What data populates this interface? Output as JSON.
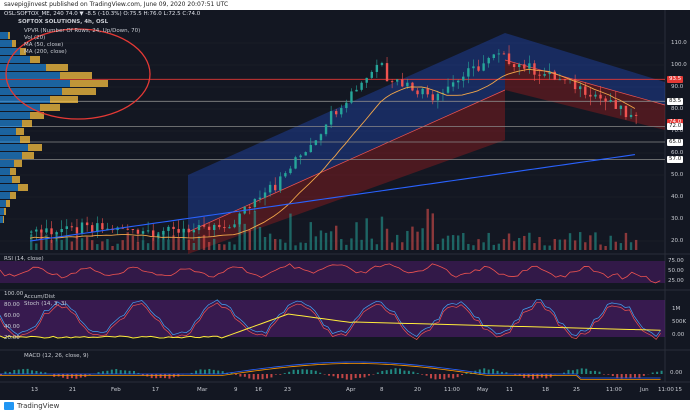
{
  "topbar": {
    "text": "savepigjinvest published on TradingView.com, June 09, 2020 20:07:51 UTC",
    "ticker": "OSL:SOFTOX_ME, 240  74.0 ▼ -8.5 (-10.3%) O:75.5 H:76.0 L:72.5 C:74.0"
  },
  "legend": {
    "title": "SOFTOX SOLUTIONS, 4h, OSL",
    "items": [
      "VPVR (Number Of Rows, 24, Up/Down, 70)",
      "Vol (20)",
      "MA (50, close)",
      "MA (200, close)"
    ]
  },
  "panes": {
    "rsi_label": "RSI (14, close)",
    "accum_label": "Accum/Dist",
    "stoch_label": "Stoch (14, 3, 3)",
    "macd_label": "MACD (12, 26, close, 9)"
  },
  "price_axis": [
    "110.0",
    "100.0",
    "90.0",
    "80.0",
    "70.0",
    "60.0",
    "50.0",
    "40.0",
    "30.0",
    "20.0"
  ],
  "price_tags": [
    {
      "text": "93.5",
      "bg": "#e53935",
      "fg": "#ffffff"
    },
    {
      "text": "83.5",
      "bg": "#ffffff",
      "fg": "#111111"
    },
    {
      "text": "74.0",
      "bg": "#e53935",
      "fg": "#ffffff"
    },
    {
      "text": "72.0",
      "bg": "#ffffff",
      "fg": "#111111"
    },
    {
      "text": "65.0",
      "bg": "#ffffff",
      "fg": "#111111"
    },
    {
      "text": "57.0",
      "bg": "#ffffff",
      "fg": "#111111"
    }
  ],
  "rsi_axis": [
    "75.00",
    "50.00",
    "25.00"
  ],
  "stoch_axis_left": [
    "100.00",
    "80.00",
    "60.00",
    "40.00",
    "20.00"
  ],
  "stoch_axis_right": [
    "1M",
    "500K",
    "0.00"
  ],
  "macd_axis": [
    "0.00"
  ],
  "time_axis": [
    "13",
    "21",
    "Feb",
    "17",
    "Mar",
    "9",
    "16",
    "23",
    "Apr",
    "8",
    "20",
    "11:00",
    "May",
    "11",
    "18",
    "25",
    "11:00",
    "Jun",
    "11:00",
    "15"
  ],
  "colors": {
    "background": "#131722",
    "up": "#26a69a",
    "down": "#ef5350",
    "ma50": "#f2a64a",
    "ma200": "#2962ff",
    "vpvr_up": "#2196f3",
    "vpvr_down": "#f9c140",
    "annotation": "#e53935"
  },
  "footer": {
    "brand": "TradingView"
  }
}
